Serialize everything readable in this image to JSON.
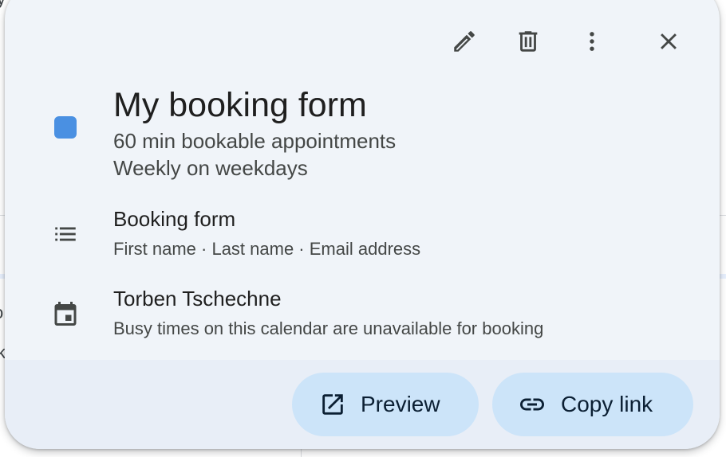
{
  "background": {
    "edge_char_1": "y",
    "edge_char_2": "o",
    "edge_char_3": "k"
  },
  "toolbar": {
    "edit_icon": "pencil-icon",
    "delete_icon": "trash-icon",
    "more_icon": "more-vert-icon",
    "close_icon": "close-icon"
  },
  "event": {
    "color": "#4a90e2",
    "title": "My booking form",
    "duration": "60 min bookable appointments",
    "recurrence": "Weekly on weekdays"
  },
  "booking_form": {
    "icon": "list-icon",
    "title": "Booking form",
    "fields": "First name · Last name · Email address"
  },
  "calendar": {
    "icon": "calendar-icon",
    "title": "Torben Tschechne",
    "note": "Busy times on this calendar are unavailable for booking"
  },
  "actions": {
    "preview_label": "Preview",
    "preview_icon": "open-in-new-icon",
    "copy_label": "Copy link",
    "copy_icon": "link-icon"
  }
}
